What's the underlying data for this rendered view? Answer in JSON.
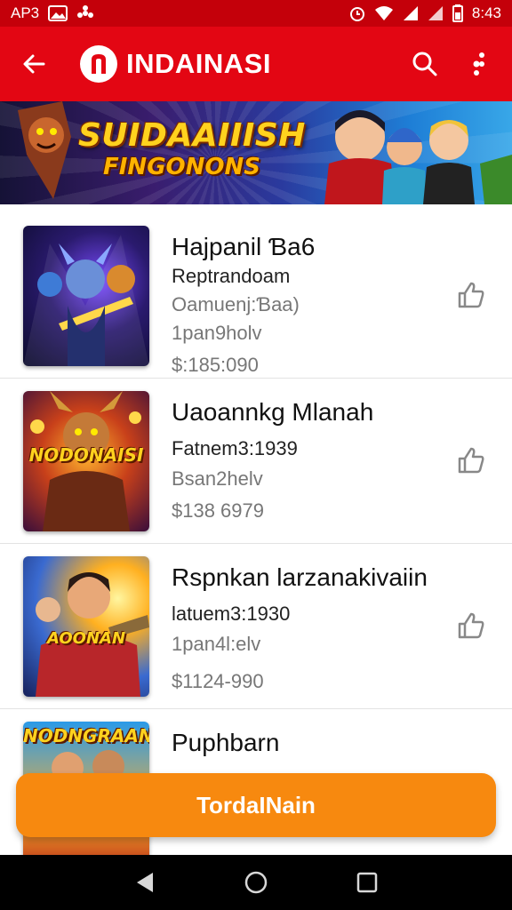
{
  "status_bar": {
    "left_text": "AP3",
    "time": "8:43",
    "icons": [
      "gallery-icon",
      "flower-icon",
      "alarm-icon",
      "wifi-icon",
      "signal-icon",
      "signal-icon",
      "battery-icon"
    ]
  },
  "app_bar": {
    "title": "INDAINASI",
    "logo_letter": "n",
    "back_icon": "arrow-left-icon",
    "search_icon": "search-icon",
    "more_icon": "more-vert-icon"
  },
  "banner": {
    "line1": "SUIDAAIIISH",
    "line2": "FINGONONS"
  },
  "items": [
    {
      "title": "Hajpanil Ɓa6",
      "subtitle": "Reptrandoam",
      "meta1": "Oamuenj:Ɓaa)",
      "meta2": "1pan9holv",
      "price": "$:185:090",
      "thumb_label": "",
      "favorite_icon": "thumb-up-outline-icon"
    },
    {
      "title": "Uaoannkg Mlanah",
      "subtitle": "Fatnem3:1939",
      "meta1": "Bsan2helv",
      "meta2": "",
      "price": "$138 6979",
      "thumb_label": "NODONAISI",
      "favorite_icon": "thumb-up-outline-icon"
    },
    {
      "title": "Rspnkan larzanakivaiin",
      "subtitle": "latuem3:1930",
      "meta1": "1pan4l:elv",
      "meta2": "",
      "price": "$1124-990",
      "thumb_label": "AOONAN",
      "favorite_icon": "thumb-up-outline-icon"
    },
    {
      "title": "Puphbarn",
      "subtitle": "",
      "meta1": "",
      "meta2": "",
      "price": "",
      "thumb_label": "NODNGRAAN",
      "favorite_icon": ""
    }
  ],
  "cta": {
    "label": "TordaINain"
  },
  "nav_bar": {
    "icons": [
      "back-triangle-icon",
      "home-circle-icon",
      "recents-square-icon"
    ]
  },
  "colors": {
    "app_bar": "#e30613",
    "status_bar": "#c4000a",
    "cta": "#f7890f",
    "nav_bar": "#000000"
  }
}
